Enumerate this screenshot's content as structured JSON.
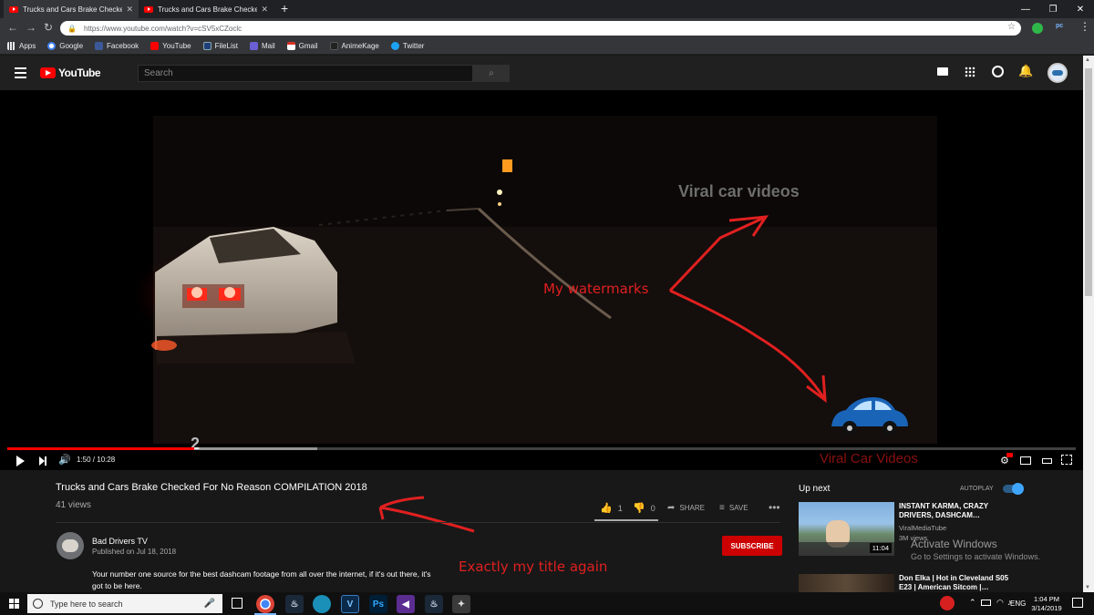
{
  "browser": {
    "tabs": [
      {
        "title": "Trucks and Cars Brake Checked -"
      },
      {
        "title": "Trucks and Cars Brake Checked F"
      }
    ],
    "new_tab": "+",
    "url": "https://www.youtube.com/watch?v=cSV5xCZoclc",
    "bookmarks": [
      "Apps",
      "Google",
      "Facebook",
      "YouTube",
      "FileList",
      "Mail",
      "Gmail",
      "AnimeKage",
      "Twitter"
    ]
  },
  "youtube": {
    "logo_text": "YouTube",
    "search_placeholder": "Search"
  },
  "video": {
    "overlay_number": "2",
    "watermark_text_top": "Viral car videos",
    "watermark_text_bottom": "Viral Car Videos",
    "annotation_watermarks": "My watermarks",
    "time_display": "1:50 / 10:28",
    "progress": 0.175,
    "buffered": 0.29
  },
  "info": {
    "title": "Trucks and Cars Brake Checked For No Reason COMPILATION 2018",
    "views": "41 views",
    "likes": "1",
    "dislikes": "0",
    "share_label": "SHARE",
    "save_label": "SAVE",
    "channel_name": "Bad Drivers TV",
    "published": "Published on Jul 18, 2018",
    "subscribe_label": "SUBSCRIBE",
    "description_line1": "Your number one source for the best dashcam footage from all over the internet, if it's out there, it's",
    "description_line2": "got to be here.",
    "annotation_title": "Exactly my title again"
  },
  "upnext": {
    "heading": "Up next",
    "autoplay_label": "AUTOPLAY",
    "items": [
      {
        "title_line1": "INSTANT KARMA, CRAZY",
        "title_line2": "DRIVERS, DASHCAM…",
        "channel": "ViralMediaTube",
        "views": "3M views",
        "duration": "11:04"
      },
      {
        "title_line1": "Don Elka | Hot in Cleveland S05",
        "title_line2": "E23 | American Sitcom |…"
      }
    ]
  },
  "activate_windows": {
    "line1": "Activate Windows",
    "line2": "Go to Settings to activate Windows."
  },
  "taskbar": {
    "search_placeholder": "Type here to search",
    "language": "ENG",
    "time": "1:04 PM",
    "date": "3/14/2019"
  },
  "colors": {
    "youtube_red": "#ff0000",
    "annotation_red": "#e02020",
    "subscribe_red": "#cc0000",
    "autoplay_blue": "#3ea6ff"
  }
}
